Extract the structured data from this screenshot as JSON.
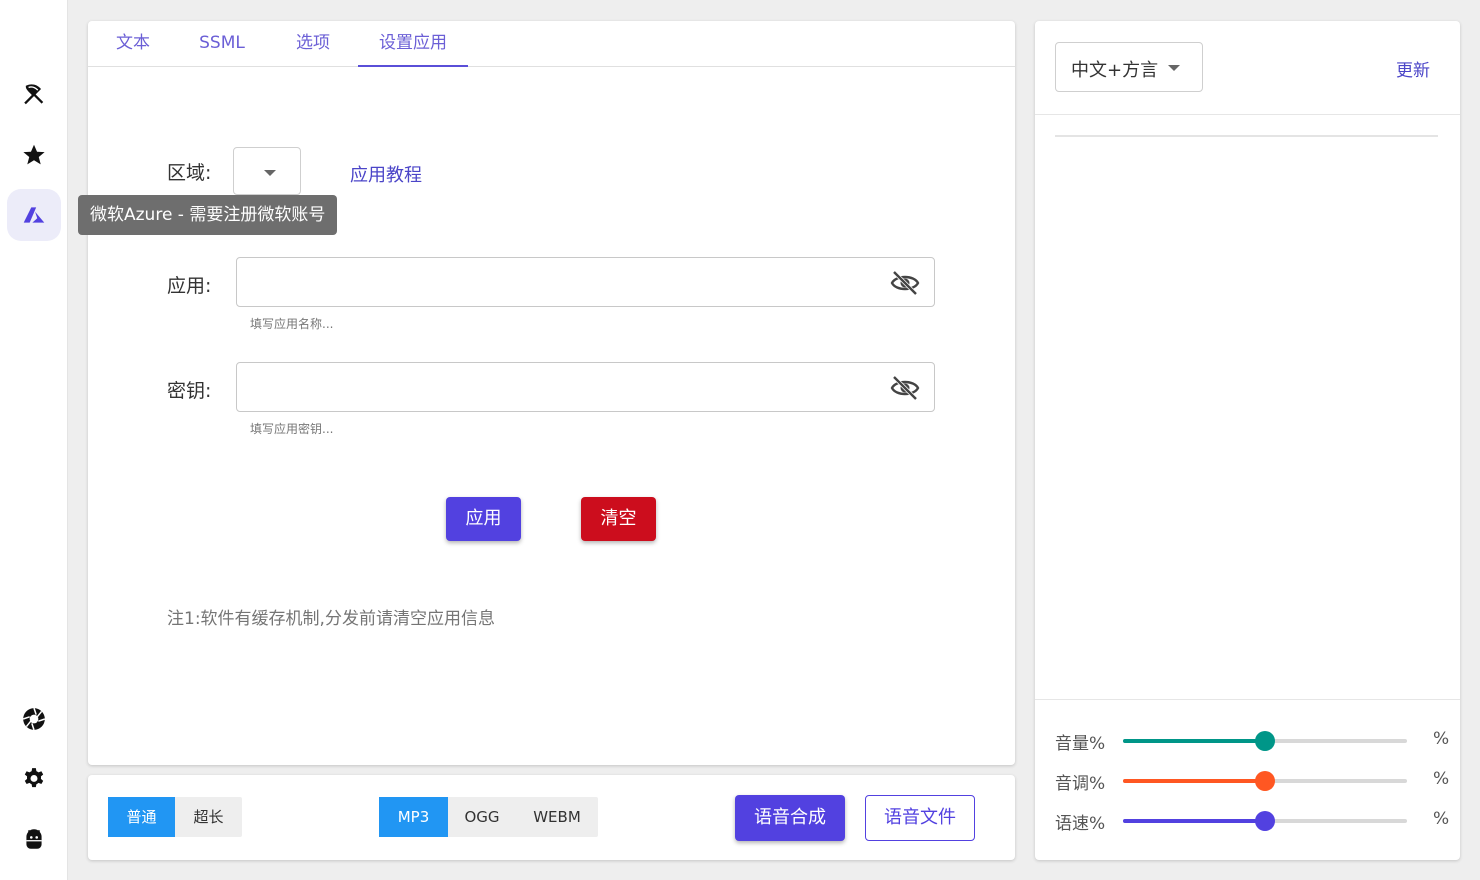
{
  "rail": {
    "top_items": [
      "umbrella-icon",
      "star-icon",
      "azure-icon"
    ],
    "bottom_items": [
      "aperture-icon",
      "gear-icon",
      "android-icon"
    ],
    "tooltip": "微软Azure - 需要注册微软账号"
  },
  "tabs": [
    {
      "label": "文本"
    },
    {
      "label": "SSML"
    },
    {
      "label": "选项"
    },
    {
      "label": "设置应用",
      "active": true
    }
  ],
  "form": {
    "region_label": "区域:",
    "tutorial_link": "应用教程",
    "app_label": "应用:",
    "app_value": "",
    "app_hint": "填写应用名称...",
    "key_label": "密钥:",
    "key_value": "",
    "key_hint": "填写应用密钥...",
    "apply_button": "应用",
    "clear_button": "清空",
    "note": "注1:软件有缓存机制,分发前请清空应用信息"
  },
  "bottom": {
    "length_modes": [
      "普通",
      "超长"
    ],
    "length_selected": "普通",
    "formats": [
      "MP3",
      "OGG",
      "WEBM"
    ],
    "format_selected": "MP3",
    "synthesize_button": "语音合成",
    "file_button": "语音文件"
  },
  "right": {
    "language_select": "中文+方言",
    "update_link": "更新",
    "sliders": [
      {
        "label": "音量%",
        "value": 50,
        "unit": "%",
        "color": "#009688"
      },
      {
        "label": "音调%",
        "value": 50,
        "unit": "%",
        "color": "#ff5722"
      },
      {
        "label": "语速%",
        "value": 50,
        "unit": "%",
        "color": "#5241e0"
      }
    ]
  },
  "colors": {
    "primary": "#5241e0",
    "danger": "#cc0d1d",
    "segment_active": "#2196f3",
    "link": "#4b45c8"
  }
}
